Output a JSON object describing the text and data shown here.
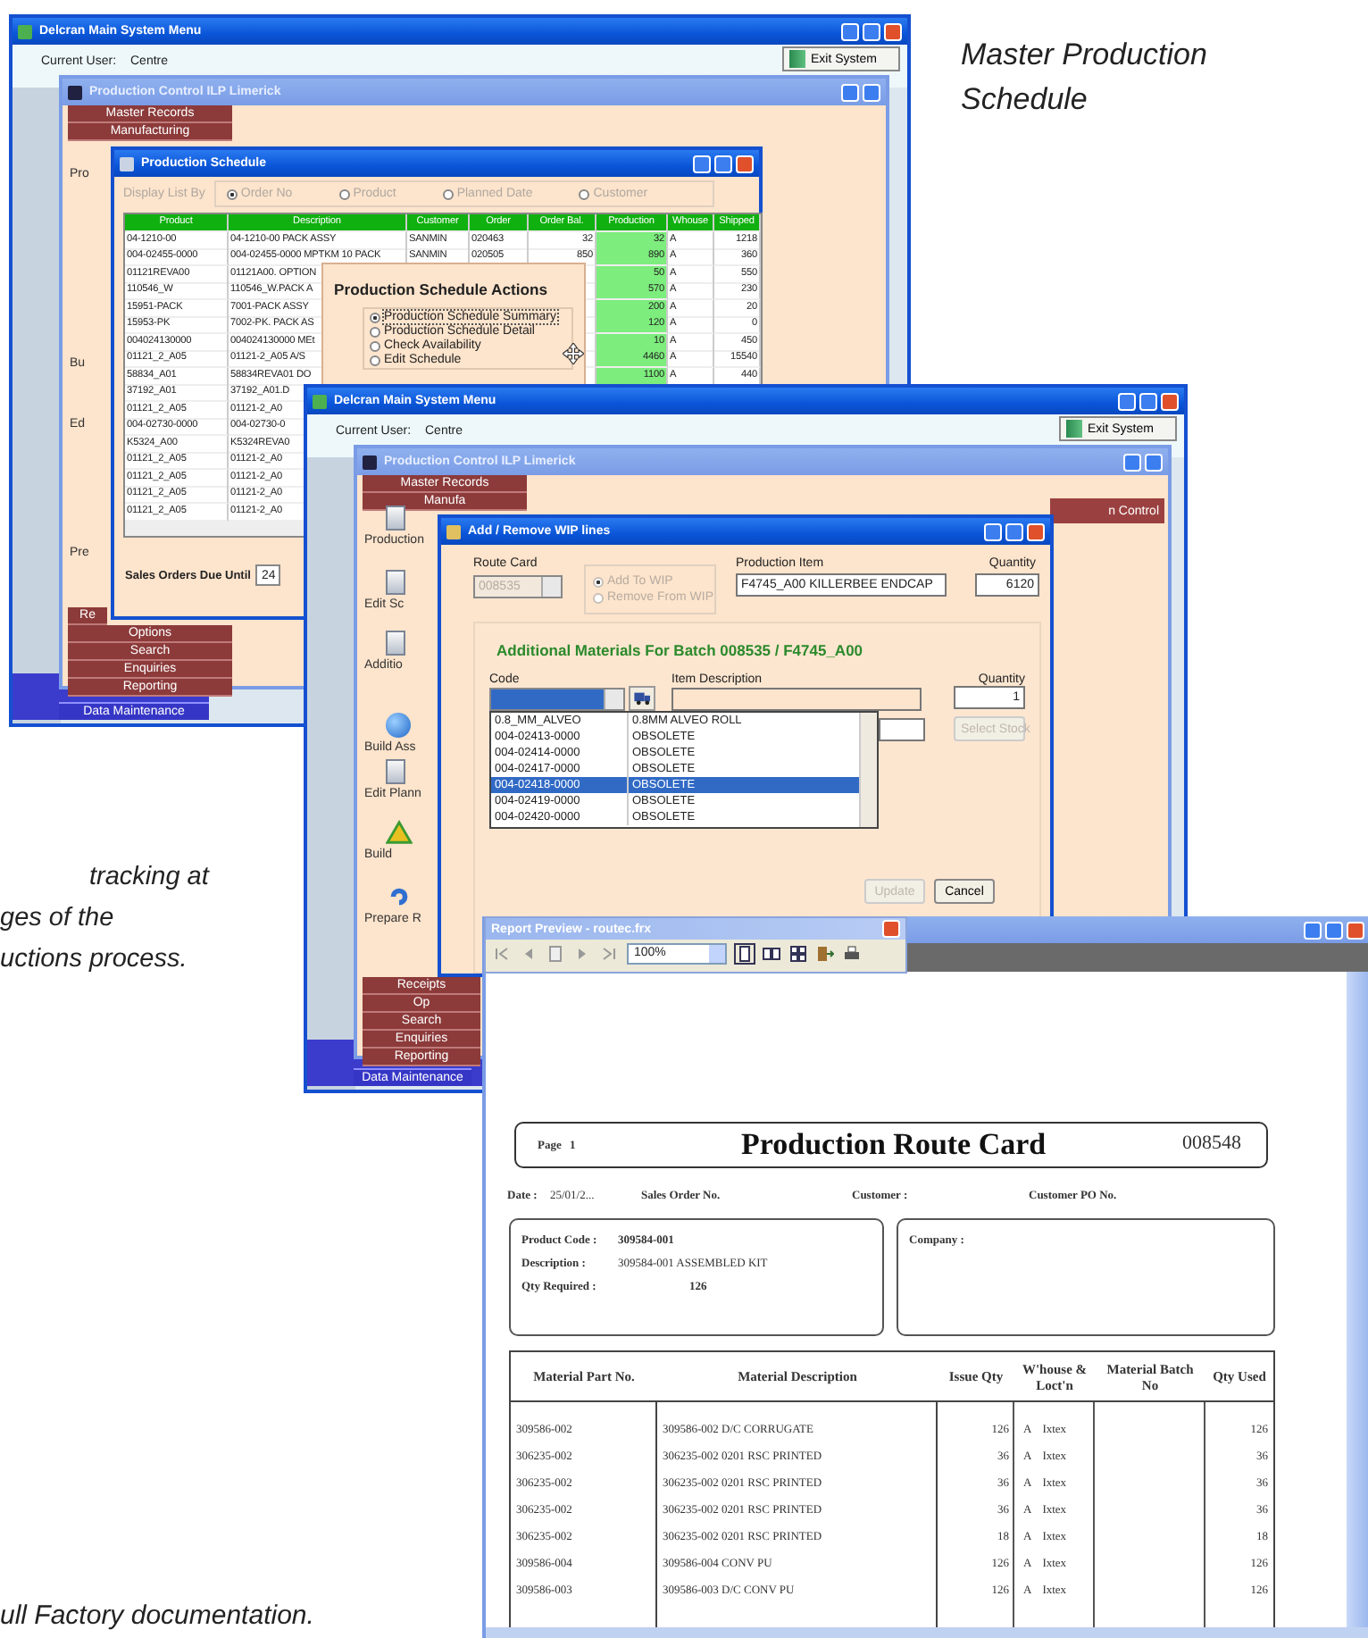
{
  "captions": {
    "top_right": "Master Production Schedule",
    "middle_left": [
      "tracking at",
      "ges of the",
      "uctions process."
    ],
    "bottom_left": "ull Factory documentation."
  },
  "screen_1": {
    "main_window": {
      "title": "Delcran Main System Menu",
      "current_user_label": "Current User:",
      "current_user": "Centre",
      "exit_button": "Exit System",
      "bottom_button": "Data Maintenance"
    },
    "control_window": {
      "title": "Production Control ILP Limerick",
      "menu_top": [
        "Master Records",
        "Manufacturing"
      ],
      "menu_bottom": [
        "Re",
        "Options",
        "Search",
        "Enquiries",
        "Reporting"
      ],
      "side_items": [
        {
          "label": "Pro"
        },
        {
          "label": "Bu"
        },
        {
          "label": "Ed"
        },
        {
          "label": "Pre"
        }
      ]
    },
    "schedule_window": {
      "title": "Production Schedule",
      "display_by": {
        "label": "Display List By",
        "disabled": true,
        "options": [
          {
            "label": "Order No",
            "selected": true
          },
          {
            "label": "Product",
            "selected": false
          },
          {
            "label": "Planned Date",
            "selected": false
          },
          {
            "label": "Customer",
            "selected": false
          }
        ]
      },
      "columns": [
        "Product",
        "Description",
        "Customer",
        "Order",
        "Order Bal.",
        "Production",
        "Whouse",
        "Shipped"
      ],
      "rows": [
        {
          "product": "04-1210-00",
          "description": "04-1210-00 PACK ASSY",
          "customer": "SANMIN",
          "order": "020463",
          "order_bal": "32",
          "production": "32",
          "whouse": "A",
          "shipped": "1218"
        },
        {
          "product": "004-02455-0000",
          "description": "004-02455-0000 MPTKM 10 PACK",
          "customer": "SANMIN",
          "order": "020505",
          "order_bal": "850",
          "production": "890",
          "whouse": "A",
          "shipped": "360"
        },
        {
          "product": "01121REVA00",
          "description": "01121A00. OPTION",
          "production": "50",
          "whouse": "A",
          "shipped": "550"
        },
        {
          "product": "110546_W",
          "description": "110546_W.PACK A",
          "production": "570",
          "whouse": "A",
          "shipped": "230"
        },
        {
          "product": "15951-PACK",
          "description": "7001-PACK ASSY",
          "production": "200",
          "whouse": "A",
          "shipped": "20"
        },
        {
          "product": "15953-PK",
          "description": "7002-PK. PACK AS",
          "production": "120",
          "whouse": "A",
          "shipped": "0"
        },
        {
          "product": "004024130000",
          "description": "004024130000 MEt",
          "production": "10",
          "whouse": "A",
          "shipped": "450"
        },
        {
          "product": "01121_2_A05",
          "description": "01121-2_A05 A/S",
          "production": "4460",
          "whouse": "A",
          "shipped": "15540"
        },
        {
          "product": "58834_A01",
          "description": "58834REVA01 DO",
          "production": "1100",
          "whouse": "A",
          "shipped": "440"
        },
        {
          "product": "37192_A01",
          "description": "37192_A01.D"
        },
        {
          "product": "01121_2_A05",
          "description": "01121-2_A0"
        },
        {
          "product": "004-02730-0000",
          "description": "004-02730-0"
        },
        {
          "product": "K5324_A00",
          "description": "K5324REVA0"
        },
        {
          "product": "01121_2_A05",
          "description": "01121-2_A0"
        },
        {
          "product": "01121_2_A05",
          "description": "01121-2_A0"
        },
        {
          "product": "01121_2_A05",
          "description": "01121-2_A0"
        },
        {
          "product": "01121_2_A05",
          "description": "01121-2_A0"
        }
      ],
      "footer_label": "Sales Orders Due Until",
      "footer_value": "24"
    },
    "actions_popup": {
      "title": "Production Schedule Actions",
      "options": [
        {
          "label": "Production Schedule Summary",
          "selected": true
        },
        {
          "label": "Production Schedule Detail",
          "selected": false
        },
        {
          "label": "Check Availability",
          "selected": false
        },
        {
          "label": "Edit Schedule",
          "selected": false
        }
      ]
    }
  },
  "screen_2": {
    "main_window": {
      "title": "Delcran Main System Menu",
      "current_user_label": "Current User:",
      "current_user": "Centre",
      "exit_button": "Exit System",
      "bottom_button": "Data Maintenance"
    },
    "control_window": {
      "title": "Production Control ILP Limerick",
      "menu_top": [
        "Master Records",
        "Manufa"
      ],
      "menu_bottom": [
        "Receipts",
        "Op",
        "Search",
        "Enquiries",
        "Reporting"
      ],
      "control_button": "n Control",
      "side_items": [
        {
          "label": "Production",
          "kind": "document"
        },
        {
          "label": "Edit Sc",
          "kind": "document"
        },
        {
          "label": "Additio",
          "kind": "document"
        },
        {
          "label": "Build Ass",
          "kind": "disc"
        },
        {
          "label": "Edit Plann",
          "kind": "document"
        },
        {
          "label": "Build",
          "kind": "triangle"
        },
        {
          "label": "Prepare R",
          "kind": "swirl"
        }
      ]
    },
    "wip_window": {
      "title": "Add / Remove WIP lines",
      "route_card": {
        "label": "Route Card",
        "value": "008535",
        "disabled": true
      },
      "modes": [
        {
          "label": "Add To WIP",
          "selected": true,
          "disabled": true
        },
        {
          "label": "Remove From WIP",
          "selected": false,
          "disabled": true
        }
      ],
      "production_item": {
        "label": "Production Item",
        "value": "F4745_A00 KILLERBEE ENDCAP"
      },
      "quantity": {
        "label": "Quantity",
        "value": "6120"
      },
      "heading": "Additional Materials For Batch 008535 / F4745_A00",
      "code_label": "Code",
      "item_description_label": "Item Description",
      "line_quantity": {
        "label": "Quantity",
        "value": "1"
      },
      "code_list": [
        {
          "code": "0.8_MM_ALVEO",
          "description": "0.8MM ALVEO ROLL",
          "selected": false
        },
        {
          "code": "004-02413-0000",
          "description": "OBSOLETE",
          "selected": false
        },
        {
          "code": "004-02414-0000",
          "description": "OBSOLETE",
          "selected": false
        },
        {
          "code": "004-02417-0000",
          "description": "OBSOLETE",
          "selected": false
        },
        {
          "code": "004-02418-0000",
          "description": "OBSOLETE",
          "selected": true
        },
        {
          "code": "004-02419-0000",
          "description": "OBSOLETE",
          "selected": false
        },
        {
          "code": "004-02420-0000",
          "description": "OBSOLETE",
          "selected": false
        }
      ],
      "buttons": [
        {
          "kind": "stock",
          "label": "Select Stock",
          "disabled": true
        },
        {
          "kind": "footer",
          "label": "Update",
          "disabled": true
        },
        {
          "kind": "footer",
          "label": "Cancel",
          "disabled": false
        }
      ]
    }
  },
  "report": {
    "toolbar_title": "Report Preview - routec.frx",
    "zoom": "100%",
    "page": {
      "page_label": "Page",
      "page_number": "1",
      "title": "Production Route Card",
      "number": "008548",
      "date_label": "Date :",
      "date": "25/01/2...",
      "sales_order_label": "Sales Order No.",
      "customer_label": "Customer :",
      "customer_po_label": "Customer PO No.",
      "product_fields": [
        {
          "label": "Product Code :",
          "value": "309584-001"
        },
        {
          "label": "Description :",
          "value": "309584-001 ASSEMBLED KIT"
        },
        {
          "label": "Qty Required :",
          "value": "126"
        }
      ],
      "company_label": "Company :",
      "columns": [
        "Material Part No.",
        "Material Description",
        "Issue Qty",
        "W'house & Loct'n",
        "Material Batch No",
        "Qty Used"
      ],
      "rows": [
        {
          "part": "309586-002",
          "description": "309586-002 D/C CORRUGATE",
          "issue_qty": "126",
          "whouse": "A",
          "location": "Ixtex",
          "used": "126"
        },
        {
          "part": "306235-002",
          "description": "306235-002 0201 RSC PRINTED",
          "issue_qty": "36",
          "whouse": "A",
          "location": "Ixtex",
          "used": "36"
        },
        {
          "part": "306235-002",
          "description": "306235-002 0201 RSC PRINTED",
          "issue_qty": "36",
          "whouse": "A",
          "location": "Ixtex",
          "used": "36"
        },
        {
          "part": "306235-002",
          "description": "306235-002 0201 RSC PRINTED",
          "issue_qty": "36",
          "whouse": "A",
          "location": "Ixtex",
          "used": "36"
        },
        {
          "part": "306235-002",
          "description": "306235-002 0201 RSC PRINTED",
          "issue_qty": "18",
          "whouse": "A",
          "location": "Ixtex",
          "used": "18"
        },
        {
          "part": "309586-004",
          "description": "309586-004 CONV PU",
          "issue_qty": "126",
          "whouse": "A",
          "location": "Ixtex",
          "used": "126"
        },
        {
          "part": "309586-003",
          "description": "309586-003 D/C CONV PU",
          "issue_qty": "126",
          "whouse": "A",
          "location": "Ixtex",
          "used": "126"
        }
      ]
    }
  }
}
